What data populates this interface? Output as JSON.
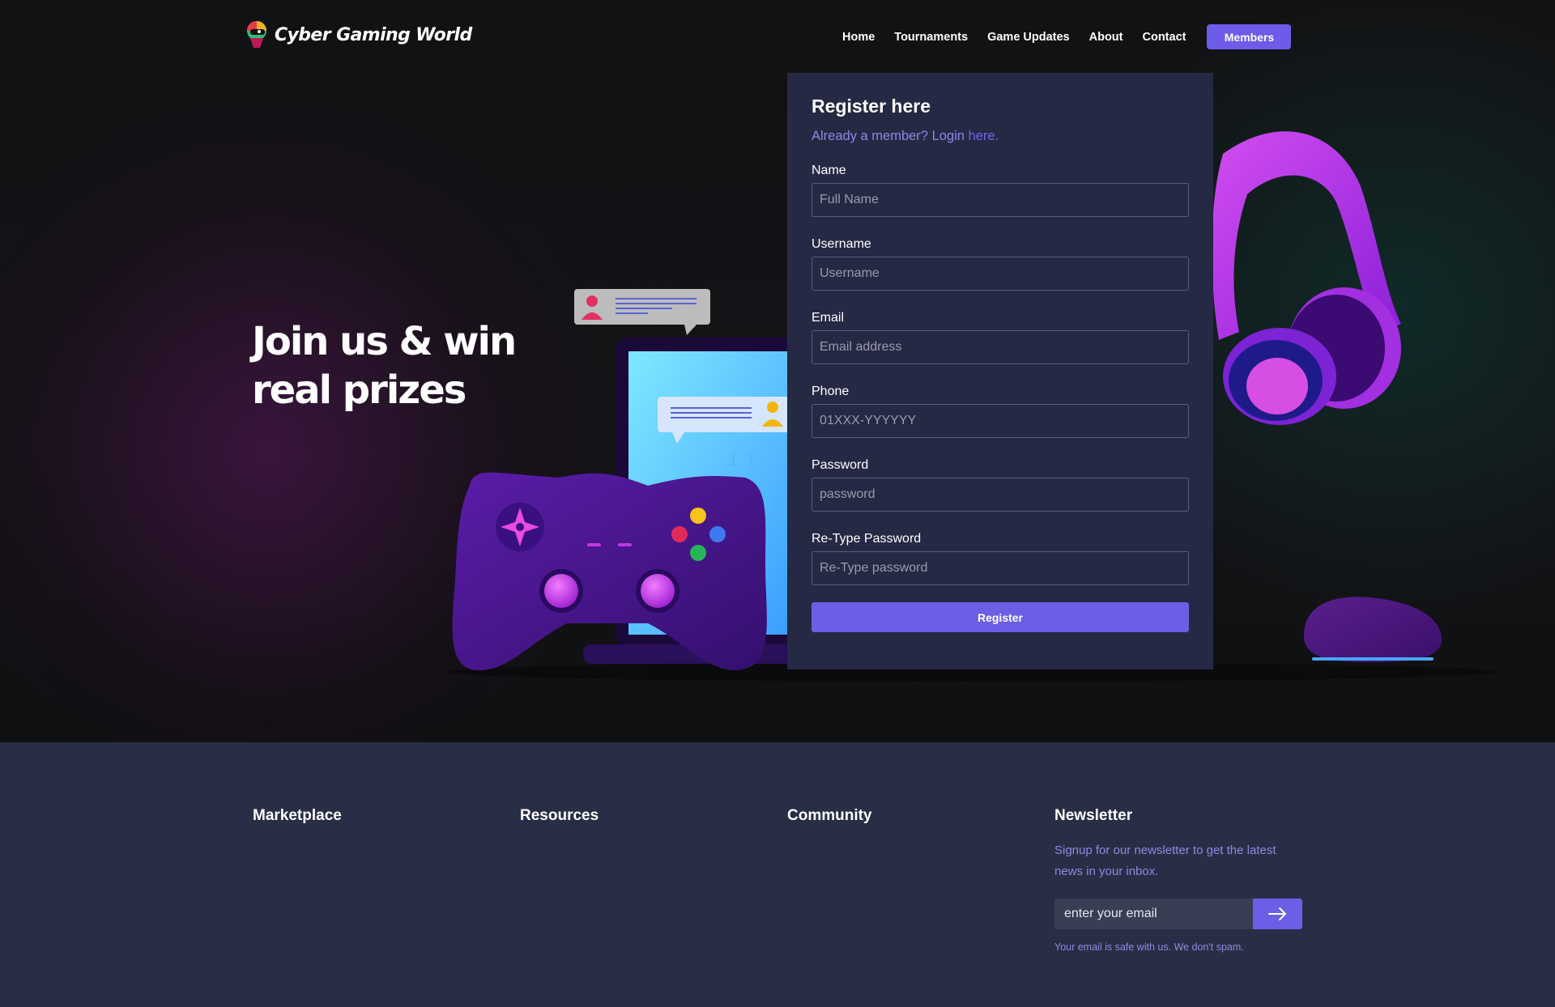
{
  "brand": {
    "name": "Cyber Gaming World"
  },
  "nav": {
    "links": [
      "Home",
      "Tournaments",
      "Game Updates",
      "About",
      "Contact"
    ],
    "members_label": "Members"
  },
  "hero": {
    "headline": "Join us & win real prizes"
  },
  "register": {
    "title": "Register here",
    "already_text": "Already a member? Login ",
    "login_link": "here.",
    "fields": [
      {
        "label": "Name",
        "placeholder": "Full Name"
      },
      {
        "label": "Username",
        "placeholder": "Username"
      },
      {
        "label": "Email",
        "placeholder": "Email address"
      },
      {
        "label": "Phone",
        "placeholder": "01XXX-YYYYYY"
      },
      {
        "label": "Password",
        "placeholder": "password"
      },
      {
        "label": "Re-Type Password",
        "placeholder": "Re-Type password"
      }
    ],
    "submit_label": "Register"
  },
  "footer": {
    "columns": [
      "Marketplace",
      "Resources",
      "Community",
      "Newsletter"
    ],
    "newsletter": {
      "text": "Signup for our newsletter to get the latest news in your inbox.",
      "placeholder": "enter your email",
      "note": "Your email is safe with us. We don't spam."
    }
  },
  "colors": {
    "accent": "#6c5ce7",
    "card": "#262944",
    "footer_bg": "#282e45",
    "link": "#8f87e8"
  },
  "icons": [
    "logo-mascot-icon",
    "arrow-right-icon",
    "gamepad-icon",
    "headphones-icon",
    "mouse-icon",
    "laptop-icon",
    "chat-bubble-icon",
    "user-icon"
  ]
}
